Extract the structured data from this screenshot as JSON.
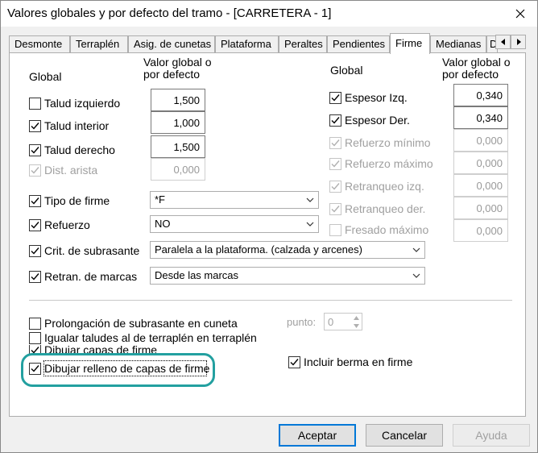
{
  "window": {
    "title": "Valores globales y por defecto del tramo  - [CARRETERA - 1]"
  },
  "tabs": [
    "Desmonte",
    "Terraplén",
    "Asig. de cunetas",
    "Plataforma",
    "Peraltes",
    "Pendientes",
    "Firme",
    "Medianas",
    "D"
  ],
  "active_tab": "Firme",
  "left": {
    "global_label": "Global",
    "value_header": [
      "Valor global o",
      "por defecto"
    ],
    "rows": [
      {
        "label": "Talud izquierdo",
        "checked": false,
        "enabled": true,
        "value": "1,500"
      },
      {
        "label": "Talud interior",
        "checked": true,
        "enabled": true,
        "value": "1,000"
      },
      {
        "label": "Talud derecho",
        "checked": true,
        "enabled": true,
        "value": "1,500"
      },
      {
        "label": "Dist. arista",
        "checked": true,
        "enabled": false,
        "value": "0,000"
      }
    ],
    "selects": [
      {
        "label": "Tipo de firme",
        "checked": true,
        "value": "*F"
      },
      {
        "label": "Refuerzo",
        "checked": true,
        "value": "NO"
      },
      {
        "label": "Crit. de subrasante",
        "checked": true,
        "value": "Paralela a la plataforma. (calzada y arcenes)"
      },
      {
        "label": "Retran. de marcas",
        "checked": true,
        "value": "Desde las marcas"
      }
    ]
  },
  "right": {
    "global_label": "Global",
    "value_header": [
      "Valor global o",
      "por defecto"
    ],
    "rows": [
      {
        "label": "Espesor Izq.",
        "checked": true,
        "enabled": true,
        "value": "0,340"
      },
      {
        "label": "Espesor Der.",
        "checked": true,
        "enabled": true,
        "value": "0,340"
      },
      {
        "label": "Refuerzo mínimo",
        "checked": true,
        "enabled": false,
        "value": "0,000"
      },
      {
        "label": "Refuerzo máximo",
        "checked": true,
        "enabled": false,
        "value": "0,000"
      },
      {
        "label": "Retranqueo izq.",
        "checked": true,
        "enabled": false,
        "value": "0,000"
      },
      {
        "label": "Retranqueo der.",
        "checked": true,
        "enabled": false,
        "value": "0,000"
      },
      {
        "label": "Fresado máximo",
        "checked": false,
        "enabled": false,
        "value": "0,000"
      }
    ]
  },
  "bottom": {
    "prolongacion": {
      "label": "Prolongación de subrasante en cuneta",
      "checked": false
    },
    "punto": {
      "label": "punto:",
      "value": "0"
    },
    "igualar": {
      "label": "Igualar taludes al de terraplén en terraplén",
      "checked": false
    },
    "dibujar_capas": {
      "label": "Dibujar capas de firme",
      "checked": true
    },
    "dibujar_relleno": {
      "label": "Dibujar relleno de capas de firme",
      "checked": true
    },
    "incluir_berma": {
      "label": "Incluir berma en firme",
      "checked": true
    }
  },
  "buttons": {
    "accept": "Aceptar",
    "cancel": "Cancelar",
    "help": "Ayuda"
  },
  "colors": {
    "highlight": "#23a0a0",
    "default_button_border": "#0078d7"
  }
}
